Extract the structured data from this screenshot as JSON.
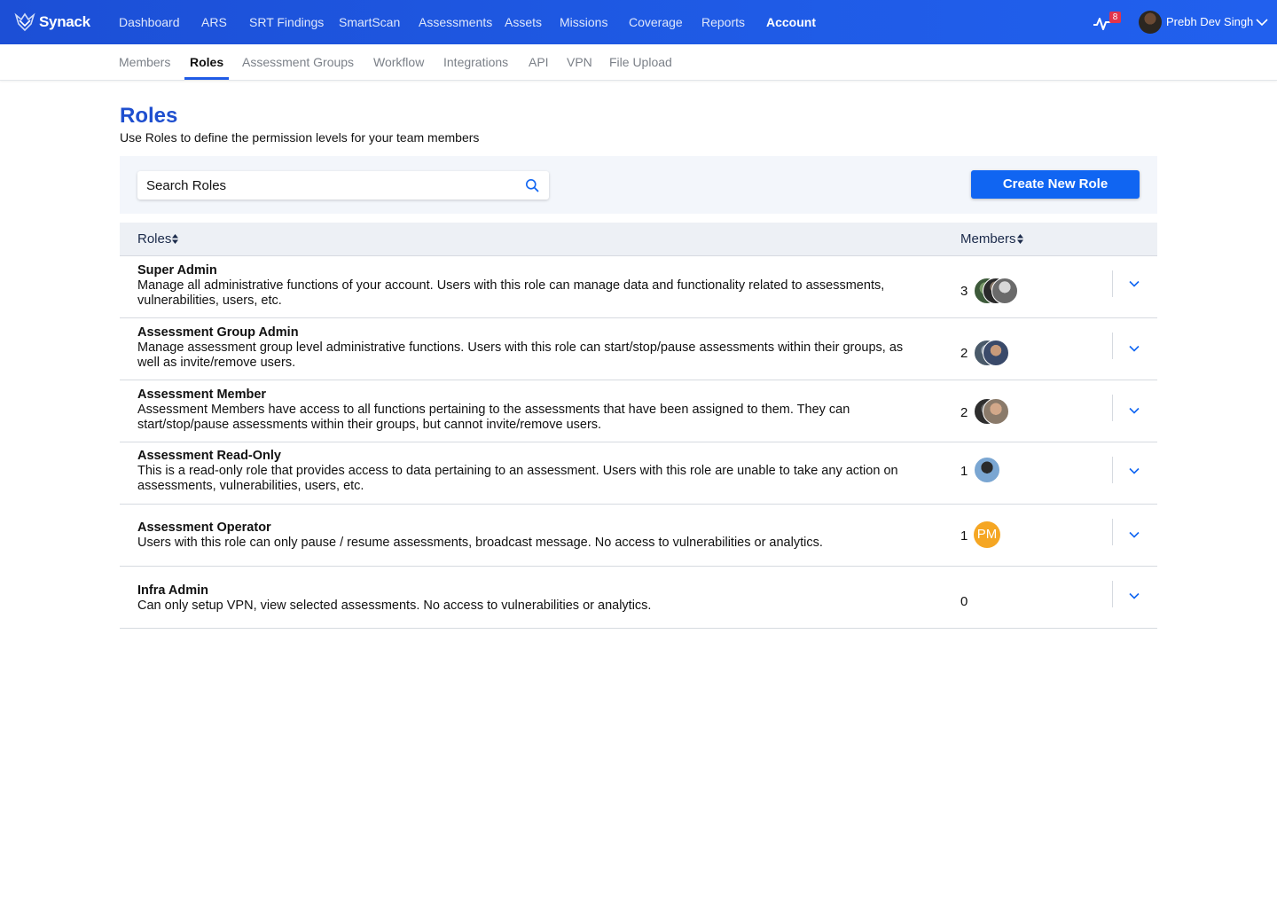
{
  "brand": {
    "name": "Synack"
  },
  "topnav": {
    "items": [
      "Dashboard",
      "ARS",
      "SRT Findings",
      "SmartScan",
      "Assessments",
      "Assets",
      "Missions",
      "Coverage",
      "Reports",
      "Account"
    ],
    "active": "Account",
    "notification_count": "8",
    "user_name": "Prebh Dev Singh"
  },
  "subnav": {
    "items": [
      "Members",
      "Roles",
      "Assessment Groups",
      "Workflow",
      "Integrations",
      "API",
      "VPN",
      "File Upload"
    ],
    "active": "Roles"
  },
  "page": {
    "title": "Roles",
    "subtitle": "Use Roles to define the permission levels for your team members"
  },
  "toolbar": {
    "search_placeholder": "Search Roles",
    "create_label": "Create New Role"
  },
  "table": {
    "columns": [
      "Roles",
      "Members"
    ],
    "rows": [
      {
        "name": "Super Admin",
        "description": "Manage all administrative functions of your account. Users with this role can manage data and functionality related to assessments, vulnerabilities, users, etc.",
        "members": "3"
      },
      {
        "name": "Assessment Group Admin",
        "description": "Manage assessment group level administrative functions. Users with this role can start/stop/pause assessments within their groups, as well as invite/remove users.",
        "members": "2"
      },
      {
        "name": "Assessment Member",
        "description": "Assessment Members have access to all functions pertaining to the assessments that have been assigned to them. They can start/stop/pause assessments within their groups, but cannot invite/remove users.",
        "members": "2"
      },
      {
        "name": "Assessment Read-Only",
        "description": "This is a read-only role that provides access to data pertaining to an assessment. Users with this role are unable to take any action on assessments, vulnerabilities, users, etc.",
        "members": "1"
      },
      {
        "name": "Assessment Operator",
        "description": "Users with this role can only pause / resume assessments, broadcast message. No access to vulnerabilities or analytics.",
        "members": "1",
        "avatar_initials": "PM"
      },
      {
        "name": "Infra Admin",
        "description": "Can only setup VPN, view selected assessments. No access to vulnerabilities or analytics.",
        "members": "0"
      }
    ]
  },
  "colors": {
    "brand_blue": "#1f5be6",
    "button_blue": "#1065f2",
    "title_blue": "#1f4fcf",
    "badge_red": "#e2344b",
    "initials_orange": "#f5a623"
  },
  "icons": [
    "synack-logo-icon",
    "activity-pulse-icon",
    "chevron-down-icon",
    "search-icon",
    "sort-icon"
  ]
}
